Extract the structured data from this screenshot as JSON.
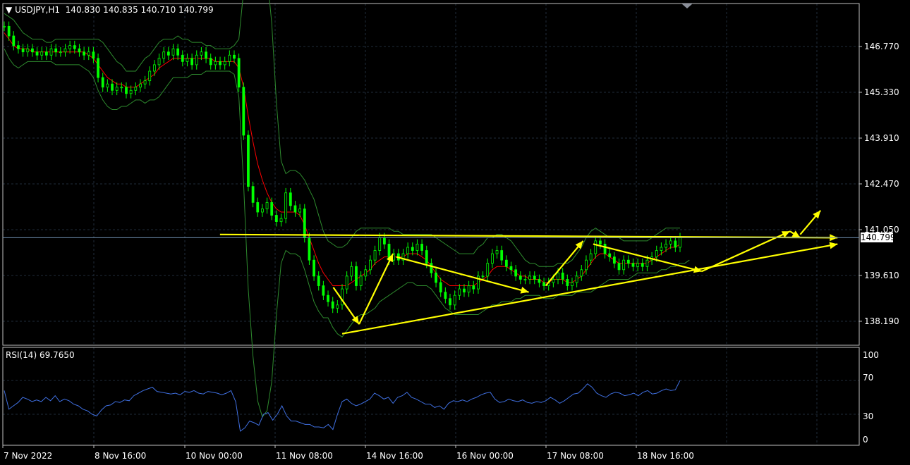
{
  "header": {
    "symbol": "USDJPY,H1",
    "open": "140.830",
    "high": "140.835",
    "low": "140.710",
    "close": "140.799"
  },
  "rsi_header": {
    "label": "RSI(14)",
    "value": "69.7650"
  },
  "current_price_label": "140.799",
  "colors": {
    "background": "#000000",
    "candles": "#00ff00",
    "bands": "#2e8b2e",
    "ma": "#ff0000",
    "annotations": "#ffff00",
    "rsi_line": "#3f6fe0",
    "grid": "#1f2b3a",
    "axis": "#c0c0c0"
  },
  "chart_data": [
    {
      "type": "line",
      "title": "USDJPY,H1",
      "y_ticks": [
        "146.770",
        "145.330",
        "143.910",
        "142.470",
        "141.050",
        "139.610",
        "138.190"
      ],
      "x_ticks": [
        "7 Nov 2022",
        "8 Nov 16:00",
        "10 Nov 00:00",
        "11 Nov 08:00",
        "14 Nov 16:00",
        "16 Nov 00:00",
        "17 Nov 08:00",
        "18 Nov 16:00"
      ],
      "ylim": [
        137.5,
        147.9
      ],
      "current_price": 140.799,
      "grid": true,
      "series": [
        {
          "kind": "price",
          "values": [
            147.4,
            147.1,
            146.8,
            146.7,
            146.6,
            146.7,
            146.6,
            146.5,
            146.6,
            146.5,
            146.7,
            146.6,
            146.6,
            146.7,
            146.8,
            146.7,
            146.6,
            146.5,
            146.6,
            146.4,
            145.8,
            145.5,
            145.6,
            145.4,
            145.5,
            145.5,
            145.3,
            145.4,
            145.5,
            145.6,
            145.7,
            146.0,
            146.2,
            146.4,
            146.6,
            146.5,
            146.7,
            146.5,
            146.3,
            146.4,
            146.2,
            146.5,
            146.6,
            146.4,
            146.2,
            146.3,
            146.2,
            146.3,
            146.5,
            146.4,
            145.5,
            144.0,
            142.4,
            141.9,
            141.6,
            141.7,
            141.9,
            141.5,
            141.3,
            141.4,
            142.2,
            141.8,
            141.6,
            141.7,
            140.8,
            140.1,
            139.6,
            139.3,
            139.0,
            138.8,
            138.6,
            138.7,
            139.2,
            139.6,
            139.9,
            139.3,
            139.6,
            139.8,
            140.1,
            140.4,
            140.8,
            140.6,
            140.1,
            140.3,
            140.1,
            140.3,
            140.5,
            140.4,
            140.6,
            140.4,
            140.0,
            139.7,
            139.4,
            139.1,
            138.9,
            138.7,
            139.0,
            139.2,
            139.1,
            139.3,
            139.2,
            139.6,
            139.6,
            140.0,
            140.3,
            140.4,
            140.1,
            139.9,
            139.8,
            139.6,
            139.5,
            139.5,
            139.6,
            139.5,
            139.4,
            139.3,
            139.4,
            139.5,
            139.7,
            139.5,
            139.3,
            139.4,
            139.6,
            139.8,
            140.1,
            140.3,
            140.7,
            140.6,
            140.3,
            140.2,
            140.0,
            139.8,
            140.1,
            140.0,
            139.9,
            140.0,
            139.9,
            140.1,
            140.2,
            140.4,
            140.5,
            140.6,
            140.7,
            140.5,
            140.8
          ]
        },
        {
          "kind": "moving_average",
          "values": [
            147.2,
            147.0,
            146.8,
            146.7,
            146.7,
            146.7,
            146.6,
            146.6,
            146.6,
            146.6,
            146.6,
            146.6,
            146.6,
            146.6,
            146.6,
            146.6,
            146.6,
            146.6,
            146.5,
            146.4,
            146.2,
            146.0,
            145.8,
            145.7,
            145.6,
            145.6,
            145.5,
            145.5,
            145.5,
            145.6,
            145.7,
            145.8,
            145.9,
            146.1,
            146.2,
            146.3,
            146.4,
            146.4,
            146.4,
            146.4,
            146.4,
            146.4,
            146.4,
            146.4,
            146.4,
            146.3,
            146.3,
            146.3,
            146.3,
            146.3,
            146.1,
            145.5,
            144.6,
            143.8,
            143.1,
            142.6,
            142.2,
            141.9,
            141.7,
            141.6,
            141.6,
            141.6,
            141.6,
            141.5,
            141.2,
            140.8,
            140.4,
            140.0,
            139.7,
            139.5,
            139.3,
            139.3,
            139.3,
            139.3,
            139.4,
            139.5,
            139.6,
            139.7,
            139.8,
            140.0,
            140.1,
            140.2,
            140.2,
            140.2,
            140.2,
            140.2,
            140.3,
            140.3,
            140.3,
            140.2,
            140.1,
            139.9,
            139.7,
            139.5,
            139.4,
            139.3,
            139.3,
            139.3,
            139.3,
            139.3,
            139.3,
            139.4,
            139.5,
            139.6,
            139.8,
            139.9,
            139.9,
            139.9,
            139.8,
            139.7,
            139.6,
            139.6,
            139.5,
            139.5,
            139.5,
            139.4,
            139.4,
            139.5,
            139.5,
            139.5,
            139.4,
            139.4,
            139.5,
            139.6,
            139.8,
            140.0,
            140.2,
            140.3,
            140.3,
            140.2,
            140.1,
            140.0,
            140.0,
            140.0,
            140.0,
            140.0,
            140.0,
            140.0,
            140.1,
            140.2,
            140.3,
            140.4,
            140.5,
            140.5,
            140.6
          ]
        },
        {
          "kind": "upper_band",
          "values": [
            147.8,
            147.7,
            147.6,
            147.4,
            147.2,
            147.1,
            147.0,
            147.0,
            147.0,
            146.9,
            146.9,
            147.0,
            147.0,
            147.0,
            147.0,
            147.0,
            147.0,
            147.0,
            147.0,
            147.0,
            147.0,
            146.9,
            146.7,
            146.5,
            146.3,
            146.2,
            146.0,
            146.0,
            146.0,
            146.2,
            146.4,
            146.5,
            146.7,
            146.9,
            147.0,
            147.0,
            147.0,
            147.1,
            147.0,
            147.0,
            146.9,
            146.9,
            146.9,
            146.8,
            146.8,
            146.7,
            146.7,
            146.7,
            146.7,
            146.8,
            147.0,
            148.5,
            150.0,
            150.5,
            150.5,
            150.0,
            149.0,
            147.5,
            145.0,
            143.2,
            142.8,
            142.9,
            142.9,
            142.8,
            142.6,
            142.3,
            142.0,
            141.5,
            141.0,
            140.7,
            140.6,
            140.5,
            140.5,
            140.6,
            140.8,
            141.0,
            141.1,
            141.1,
            141.1,
            141.1,
            141.1,
            141.1,
            141.1,
            141.0,
            141.0,
            140.9,
            140.9,
            140.9,
            140.9,
            140.9,
            140.9,
            140.9,
            140.8,
            140.7,
            140.6,
            140.5,
            140.4,
            140.3,
            140.3,
            140.3,
            140.3,
            140.5,
            140.6,
            140.8,
            140.8,
            140.9,
            140.9,
            140.8,
            140.7,
            140.5,
            140.3,
            140.1,
            140.0,
            140.0,
            139.9,
            139.9,
            139.9,
            139.9,
            140.0,
            140.0,
            140.0,
            140.1,
            140.3,
            140.5,
            140.8,
            141.0,
            141.1,
            141.0,
            140.9,
            140.8,
            140.8,
            140.8,
            140.7,
            140.7,
            140.7,
            140.7,
            140.7,
            140.7,
            140.8,
            140.9,
            141.0,
            141.1,
            141.1,
            141.1,
            141.1
          ]
        },
        {
          "kind": "lower_band",
          "values": [
            146.7,
            146.4,
            146.2,
            146.1,
            146.2,
            146.3,
            146.3,
            146.3,
            146.3,
            146.3,
            146.3,
            146.2,
            146.2,
            146.2,
            146.2,
            146.2,
            146.2,
            146.1,
            146.0,
            145.8,
            145.4,
            145.1,
            144.9,
            144.8,
            144.8,
            144.9,
            144.9,
            145.0,
            145.1,
            145.1,
            145.0,
            145.1,
            145.1,
            145.2,
            145.4,
            145.6,
            145.8,
            145.8,
            145.8,
            145.8,
            145.9,
            145.9,
            145.9,
            146.0,
            146.0,
            146.0,
            146.0,
            146.0,
            146.0,
            145.9,
            145.2,
            142.5,
            139.2,
            137.1,
            135.7,
            135.2,
            135.4,
            136.3,
            138.4,
            140.0,
            140.4,
            140.3,
            140.3,
            140.2,
            139.8,
            139.3,
            138.8,
            138.5,
            138.3,
            138.3,
            138.0,
            137.8,
            137.7,
            137.9,
            138.1,
            138.3,
            138.4,
            138.4,
            138.5,
            138.6,
            138.8,
            138.9,
            139.0,
            139.1,
            139.2,
            139.3,
            139.4,
            139.4,
            139.3,
            139.3,
            139.3,
            139.2,
            139.0,
            138.8,
            138.6,
            138.5,
            138.4,
            138.4,
            138.4,
            138.4,
            138.4,
            138.4,
            138.5,
            138.6,
            138.7,
            138.7,
            138.8,
            138.8,
            138.8,
            138.9,
            138.9,
            139.0,
            139.0,
            139.0,
            139.0,
            138.9,
            138.9,
            138.9,
            139.0,
            139.0,
            139.0,
            139.0,
            139.1,
            139.1,
            139.1,
            139.1,
            139.2,
            139.3,
            139.4,
            139.5,
            139.5,
            139.5,
            139.5,
            139.5,
            139.6,
            139.7,
            139.7,
            139.7,
            139.7,
            139.7,
            139.8,
            139.8,
            139.9,
            139.9,
            140.0,
            140.0,
            140.1
          ]
        }
      ],
      "annotations": {
        "arrows": [
          {
            "x1": 11.87,
            "y1": 139.25,
            "x2": 12.25,
            "y2": 138.1
          },
          {
            "x1": 12.25,
            "y1": 138.1,
            "x2": 12.75,
            "y2": 140.3
          },
          {
            "x1": 12.8,
            "y1": 140.2,
            "x2": 14.75,
            "y2": 139.1
          },
          {
            "x1": 15.0,
            "y1": 139.3,
            "x2": 15.55,
            "y2": 140.7
          },
          {
            "x1": 15.7,
            "y1": 140.6,
            "x2": 17.3,
            "y2": 139.75
          },
          {
            "x1": 17.3,
            "y1": 139.75,
            "x2": 18.6,
            "y2": 141.0
          },
          {
            "x1": 18.6,
            "y1": 141.0,
            "x2": 18.75,
            "y2": 140.8
          },
          {
            "x1": 18.75,
            "y1": 140.9,
            "x2": 19.05,
            "y2": 141.65
          },
          {
            "x1": 10.2,
            "y1": 140.9,
            "x2": 19.3,
            "y2": 140.8
          },
          {
            "x1": 12.0,
            "y1": 137.8,
            "x2": 19.3,
            "y2": 140.6
          }
        ]
      }
    },
    {
      "type": "line",
      "title": "RSI(14)",
      "y_ticks": [
        "100",
        "70",
        "30",
        "0"
      ],
      "ylim": [
        0,
        100
      ],
      "series": [
        {
          "name": "RSI(14)",
          "values": [
            58,
            36,
            40,
            44,
            50,
            48,
            45,
            47,
            45,
            50,
            46,
            52,
            45,
            48,
            46,
            42,
            40,
            36,
            34,
            30,
            28,
            35,
            40,
            41,
            45,
            44,
            47,
            46,
            52,
            55,
            58,
            60,
            62,
            57,
            56,
            55,
            54,
            55,
            53,
            57,
            56,
            58,
            55,
            54,
            57,
            56,
            55,
            53,
            55,
            58,
            45,
            10,
            14,
            22,
            20,
            17,
            30,
            32,
            23,
            30,
            40,
            28,
            22,
            22,
            20,
            18,
            18,
            15,
            15,
            14,
            18,
            12,
            30,
            45,
            48,
            43,
            40,
            42,
            45,
            48,
            55,
            52,
            48,
            50,
            43,
            50,
            52,
            56,
            50,
            48,
            45,
            42,
            42,
            38,
            40,
            36,
            43,
            46,
            45,
            47,
            45,
            48,
            50,
            53,
            55,
            56,
            48,
            44,
            45,
            48,
            46,
            45,
            47,
            44,
            43,
            45,
            44,
            46,
            50,
            47,
            43,
            46,
            50,
            54,
            55,
            60,
            66,
            62,
            55,
            52,
            50,
            54,
            56,
            55,
            52,
            53,
            55,
            52,
            56,
            58,
            54,
            55,
            58,
            60,
            58,
            59,
            70
          ]
        }
      ]
    }
  ]
}
